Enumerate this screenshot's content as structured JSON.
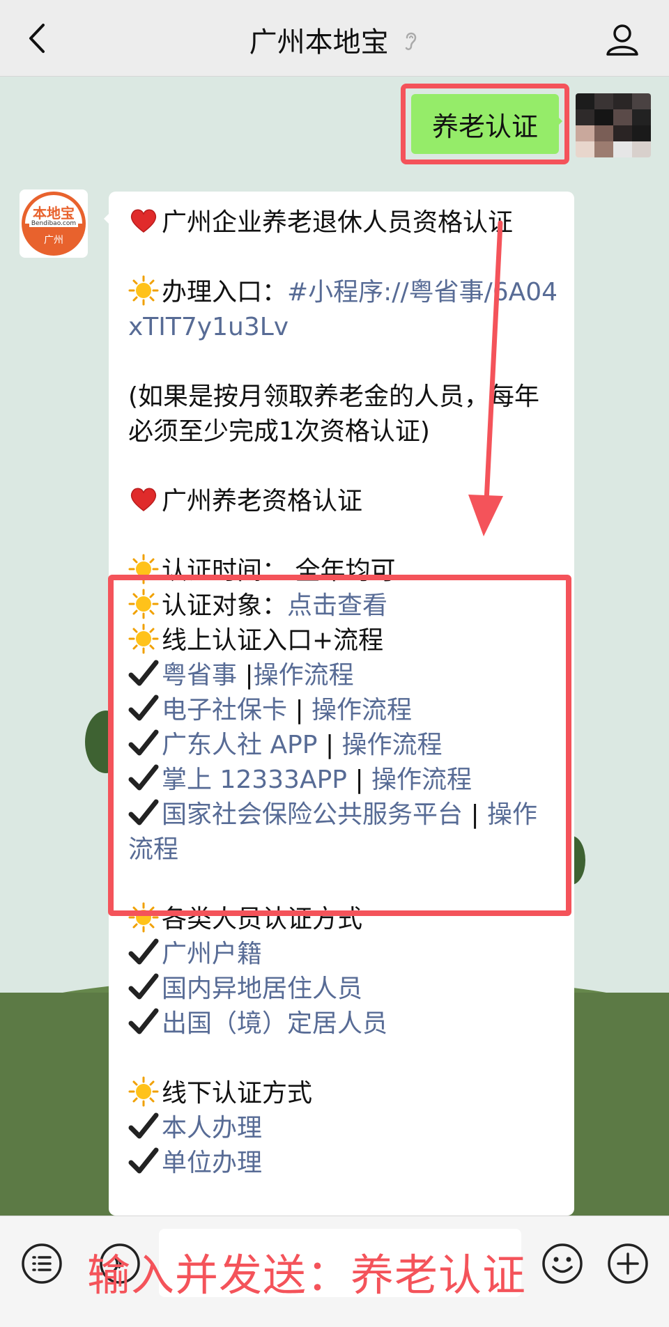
{
  "header": {
    "title": "广州本地宝"
  },
  "sent_message": {
    "text": "养老认证"
  },
  "bot_avatar": {
    "brand_text": "本地宝",
    "site_text": "Bendibao.com",
    "city_text": "广州"
  },
  "message": {
    "section1_title": "广州企业养老退休人员资格认证",
    "entry_label": "办理入口：",
    "entry_link": "#小程序://粤省事/6A04xTIT7y1u3Lv",
    "note": "(如果是按月领取养老金的人员，每年必须至少完成1次资格认证)",
    "section2_title": "广州养老资格认证",
    "time_label": "认证时间：",
    "time_value": " 全年均可",
    "target_label": "认证对象：",
    "target_link": "点击查看",
    "online_label": "线上认证入口+流程",
    "online_items": [
      {
        "name": "粤省事 ",
        "sep": "|",
        "flow": "操作流程"
      },
      {
        "name": "电子社保卡 ",
        "sep": "| ",
        "flow": "操作流程"
      },
      {
        "name": "广东人社 APP ",
        "sep": "| ",
        "flow": "操作流程"
      },
      {
        "name": "掌上 12333APP ",
        "sep": "| ",
        "flow": "操作流程"
      },
      {
        "name": "国家社会保险公共服务平台 ",
        "sep": "| ",
        "flow": "操作流程"
      }
    ],
    "types_label": "各类人员认证方式",
    "type_items": [
      "广州户籍",
      "国内异地居住人员",
      "出国（境）定居人员"
    ],
    "offline_label": "线下认证方式",
    "offline_items": [
      "本人办理",
      "单位办理"
    ]
  },
  "bottom": {
    "caption": "输入并发送：养老认证"
  },
  "colors": {
    "accent_red": "#f4535a",
    "link_blue": "#576b95",
    "sent_green": "#95ec69"
  },
  "icons": [
    "back-icon",
    "ear-icon",
    "profile-icon",
    "heart-icon",
    "sun-icon",
    "check-icon",
    "list-menu-icon",
    "voice-icon",
    "emoji-icon",
    "plus-icon"
  ]
}
